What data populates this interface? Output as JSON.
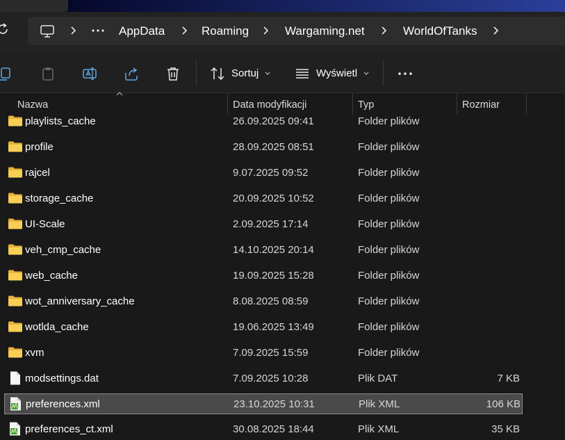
{
  "breadcrumb": {
    "items": [
      "AppData",
      "Roaming",
      "Wargaming.net",
      "WorldOfTanks"
    ]
  },
  "toolbar": {
    "sort_label": "Sortuj",
    "view_label": "Wyświetl"
  },
  "columns": {
    "name": "Nazwa",
    "modified": "Data modyfikacji",
    "type": "Typ",
    "size": "Rozmiar"
  },
  "files": [
    {
      "name": "playlists_cache",
      "modified": "26.09.2025 09:41",
      "type": "Folder plików",
      "size": "",
      "icon": "folder-icon"
    },
    {
      "name": "profile",
      "modified": "28.09.2025 08:51",
      "type": "Folder plików",
      "size": "",
      "icon": "folder-icon"
    },
    {
      "name": "rajcel",
      "modified": "9.07.2025 09:52",
      "type": "Folder plików",
      "size": "",
      "icon": "folder-icon"
    },
    {
      "name": "storage_cache",
      "modified": "20.09.2025 10:52",
      "type": "Folder plików",
      "size": "",
      "icon": "folder-icon"
    },
    {
      "name": "UI-Scale",
      "modified": "2.09.2025 17:14",
      "type": "Folder plików",
      "size": "",
      "icon": "folder-icon"
    },
    {
      "name": "veh_cmp_cache",
      "modified": "14.10.2025 20:14",
      "type": "Folder plików",
      "size": "",
      "icon": "folder-icon"
    },
    {
      "name": "web_cache",
      "modified": "19.09.2025 15:28",
      "type": "Folder plików",
      "size": "",
      "icon": "folder-icon"
    },
    {
      "name": "wot_anniversary_cache",
      "modified": "8.08.2025 08:59",
      "type": "Folder plików",
      "size": "",
      "icon": "folder-icon"
    },
    {
      "name": "wotlda_cache",
      "modified": "19.06.2025 13:49",
      "type": "Folder plików",
      "size": "",
      "icon": "folder-icon"
    },
    {
      "name": "xvm",
      "modified": "7.09.2025 15:59",
      "type": "Folder plików",
      "size": "",
      "icon": "folder-icon"
    },
    {
      "name": "modsettings.dat",
      "modified": "7.09.2025 10:28",
      "type": "Plik DAT",
      "size": "7 KB",
      "icon": "file-icon"
    },
    {
      "name": "preferences.xml",
      "modified": "23.10.2025 10:31",
      "type": "Plik XML",
      "size": "106 KB",
      "icon": "xml-file-icon"
    },
    {
      "name": "preferences_ct.xml",
      "modified": "30.08.2025 18:44",
      "type": "Plik XML",
      "size": "35 KB",
      "icon": "xml-file-icon"
    }
  ],
  "selected_file": "preferences.xml",
  "colors": {
    "background": "#191919",
    "folder": "#f5c342",
    "selection": "#4a4a4a",
    "selection_border": "#8a8a8a"
  }
}
